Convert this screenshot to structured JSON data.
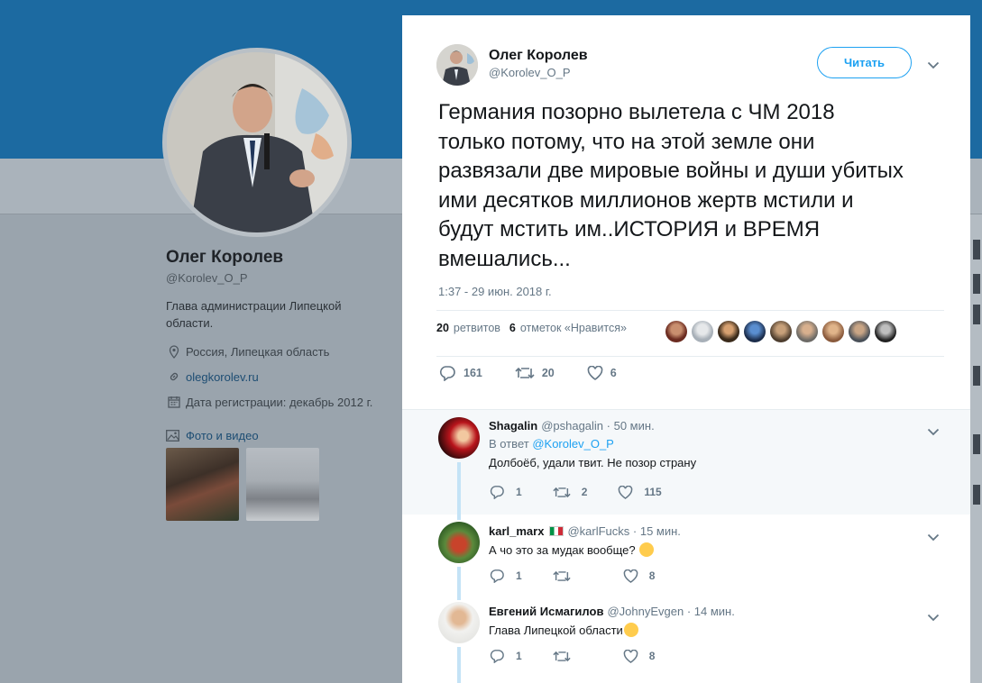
{
  "profile": {
    "name": "Олег Королев",
    "handle": "@Korolev_O_P",
    "bio": "Глава администрации Липецкой области.",
    "location": "Россия, Липецкая область",
    "website": "olegkorolev.ru",
    "joined": "Дата регистрации: декабрь 2012 г.",
    "photos_label": "Фото и видео"
  },
  "tweet": {
    "author_name": "Олег Королев",
    "author_handle": "@Korolev_O_P",
    "follow_label": "Читать",
    "text": "Германия позорно вылетела с ЧМ 2018 только потому, что на этой земле они развязали две мировые войны и души убитых ими десятков миллионов жертв мстили и будут мстить им..ИСТОРИЯ и ВРЕМЯ вмешались...",
    "timestamp": "1:37 - 29 июн. 2018 г.",
    "retweets_count": "20",
    "retweets_label": "ретвитов",
    "likes_count": "6",
    "likes_label": "отметок «Нравится»",
    "actions": {
      "replies": "161",
      "retweets": "20",
      "likes": "6"
    }
  },
  "replies": [
    {
      "name": "Shagalin",
      "handle": "@pshagalin",
      "time": "· 50 мин.",
      "reply_to_prefix": "В ответ",
      "reply_to_handle": "@Korolev_O_P",
      "text": "Долбоёб, удали твит. Не позор страну",
      "replies": "1",
      "retweets": "2",
      "likes": "115"
    },
    {
      "name": "karl_marx",
      "handle": "@karlFucks",
      "time": "· 15 мин.",
      "text": "А чо это за мудак вообще?",
      "replies": "1",
      "retweets": "",
      "likes": "8"
    },
    {
      "name": "Евгений Исмагилов",
      "handle": "@JohnyEvgen",
      "time": "· 14 мин.",
      "text": "Глава Липецкой области",
      "replies": "1",
      "retweets": "",
      "likes": "8"
    }
  ],
  "colors": {
    "accent": "#1da1f2",
    "header_bg": "#1c6aa1",
    "text_secondary": "#657786"
  }
}
